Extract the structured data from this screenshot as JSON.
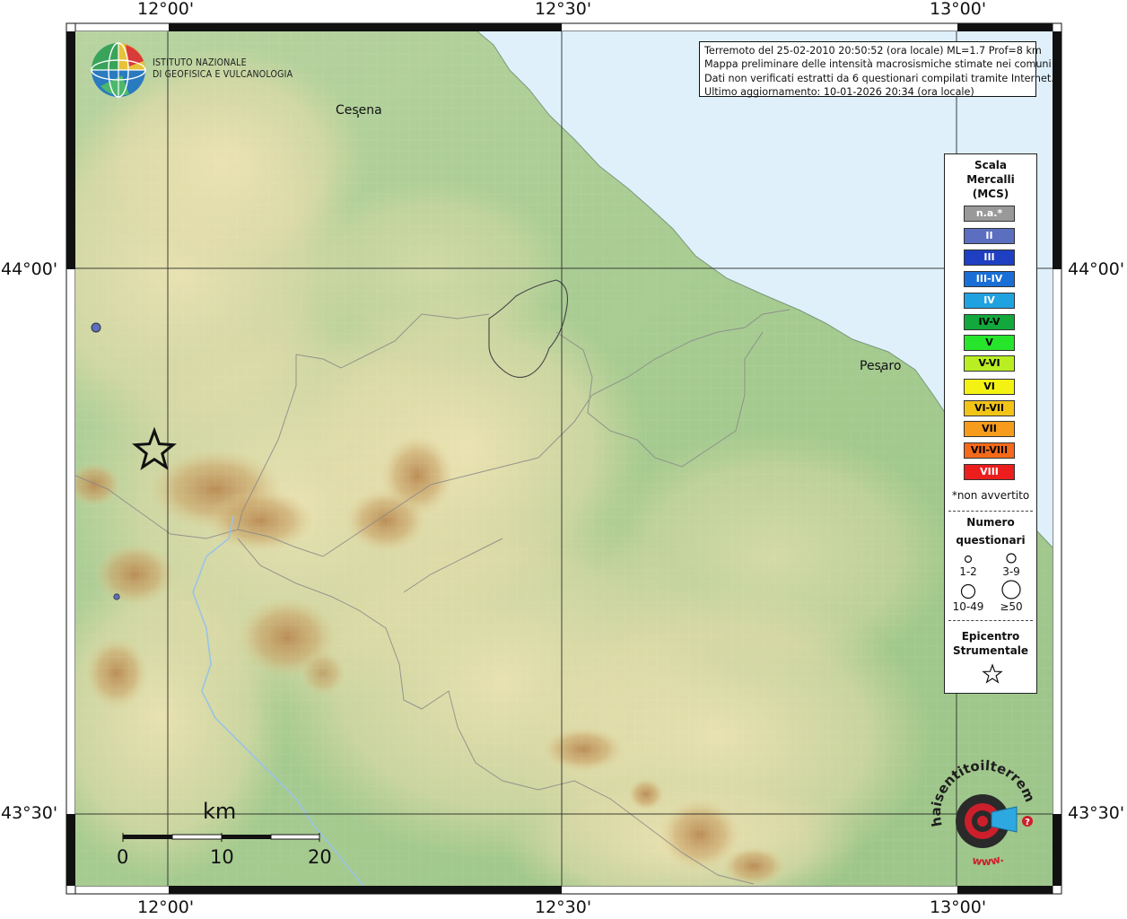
{
  "map": {
    "frame_top_labels": [
      "12°00'",
      "12°30'",
      "13°00'"
    ],
    "frame_bottom_labels": [
      "12°00'",
      "12°30'",
      "13°00'"
    ],
    "frame_left_labels": [
      "44°00'",
      "43°30'"
    ],
    "frame_right_labels": [
      "44°00'",
      "43°30'"
    ],
    "cities": [
      "Cesena",
      "Pesaro"
    ],
    "colors": {
      "sea": "#dff0fb",
      "lowland": "#a8cc92",
      "hills": "#e6dcaa",
      "mountains": "#c49a5e",
      "intensity_II": "#5b6ec0"
    }
  },
  "institute": {
    "line1": "ISTITUTO NAZIONALE",
    "line2": "DI GEOFISICA E VULCANOLOGIA",
    "icon": "ingv-globe-logo"
  },
  "info": {
    "line1": "Terremoto del 25-02-2010 20:50:52 (ora locale) ML=1.7 Prof=8 km",
    "line2": "Mappa preliminare delle intensità macrosismiche stimate nei comuni",
    "line3": "Dati non verificati estratti da 6 questionari compilati tramite Internet.",
    "line4": "Ultimo aggiornamento: 10-01-2026 20:34 (ora locale)"
  },
  "legend": {
    "title1": "Scala",
    "title2": "Mercalli",
    "title3": "(MCS)",
    "scale": [
      {
        "label": "n.a.*",
        "color": "#999999",
        "text_color": "#ffffff"
      },
      {
        "label": "II",
        "color": "#5b6ec0",
        "text_color": "#ffffff"
      },
      {
        "label": "III",
        "color": "#1f3fc2",
        "text_color": "#ffffff"
      },
      {
        "label": "III-IV",
        "color": "#1a6fd6",
        "text_color": "#ffffff"
      },
      {
        "label": "IV",
        "color": "#21a2e0",
        "text_color": "#ffffff"
      },
      {
        "label": "IV-V",
        "color": "#12a83c",
        "text_color": "#000000"
      },
      {
        "label": "V",
        "color": "#27e52a",
        "text_color": "#000000"
      },
      {
        "label": "V-VI",
        "color": "#b9ee22",
        "text_color": "#000000"
      },
      {
        "label": "VI",
        "color": "#f4f212",
        "text_color": "#000000"
      },
      {
        "label": "VI-VII",
        "color": "#f2c418",
        "text_color": "#000000"
      },
      {
        "label": "VII",
        "color": "#f79b1d",
        "text_color": "#000000"
      },
      {
        "label": "VII-VIII",
        "color": "#f46a1a",
        "text_color": "#000000"
      },
      {
        "label": "VIII",
        "color": "#ec1d1d",
        "text_color": "#ffffff"
      }
    ],
    "note": "*non avvertito",
    "count_title1": "Numero",
    "count_title2": "questionari",
    "sizes": [
      "1-2",
      "3-9",
      "10-49",
      "≥50"
    ],
    "epi_title1": "Epicentro",
    "epi_title2": "Strumentale",
    "epi_icon": "star-icon"
  },
  "scalebar": {
    "unit": "km",
    "ticks": [
      "0",
      "10",
      "20"
    ]
  },
  "badge": {
    "text": "haisentitoilterremoto.it",
    "www": "www.",
    "icon": "target-megaphone-icon"
  }
}
